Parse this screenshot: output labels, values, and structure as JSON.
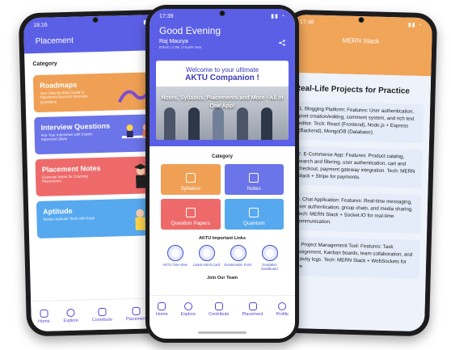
{
  "left_phone": {
    "status_time": "18:16",
    "title": "Placement",
    "category_label": "Category",
    "cards": [
      {
        "title": "Roadmaps",
        "subtitle": "Your Step-by-Step Guide to Placement Success Interview Questions",
        "color": "#f0a055"
      },
      {
        "title": "Interview Questions",
        "subtitle": "Ace Your Interviews with Expert-Approved Q&As",
        "color": "#6b74e8"
      },
      {
        "title": "Placement Notes",
        "subtitle": "Essential Notes for Cracking Placements",
        "color": "#ee6a6a"
      },
      {
        "title": "Aptitude",
        "subtitle": "Master Aptitude Tests with Ease",
        "color": "#56a9ef"
      }
    ],
    "nav": [
      "Home",
      "Explore",
      "Contribute",
      "Placement",
      "Pr"
    ]
  },
  "center_phone": {
    "status_time": "17:39",
    "greeting": "Good Evening",
    "name": "Raj Maurya",
    "subinfo": "BTech | CSE | Fourth Year",
    "banner_line1": "Welcome to your ultimate",
    "banner_line2": "AKTU Companion !",
    "banner_caption": "Notes, Syllabus, Placements and More - All in One App!",
    "category_label": "Category",
    "tiles": [
      {
        "label": "Syllabus",
        "color": "#f0a055"
      },
      {
        "label": "Notes",
        "color": "#6b74e8"
      },
      {
        "label": "Question Papers",
        "color": "#ee6a6a"
      },
      {
        "label": "Quantum",
        "color": "#56a9ef"
      }
    ],
    "links_title": "AKTU Important Links",
    "links": [
      "AKTU One-View",
      "Latest Admit Card",
      "Examination Form",
      "Gradation Dashboard"
    ],
    "team_label": "Join Our Team",
    "nav": [
      "Home",
      "Explore",
      "Contribute",
      "Placement",
      "Profile"
    ]
  },
  "right_phone": {
    "status_time": "17:48",
    "title": "MERN Stack",
    "heading": "Real-Life Projects for Practice",
    "items": [
      "1. Blogging Platform: Features: User authentication, post creation/editing, comment system, and rich text editor. Tech: React (Frontend), Node.js + Express (Backend), MongoDB (Database).",
      "2. E-Commerce App: Features: Product catalog, search and filtering, user authentication, cart and checkout, payment gateway integration. Tech: MERN Stack + Stripe for payments.",
      "3. Chat Application: Features: Real-time messaging, user authentication, group chats, and media sharing. Tech: MERN Stack + Socket.IO for real-time communication.",
      "4. Project Management Tool: Features: Task assignment, Kanban boards, team collaboration, and activity logs. Tech: MERN Stack + WebSockets for live"
    ]
  },
  "colors": {
    "primary": "#5b5fe6",
    "accent_orange": "#f0a055",
    "accent_red": "#ee6a6a",
    "accent_sky": "#56a9ef"
  }
}
